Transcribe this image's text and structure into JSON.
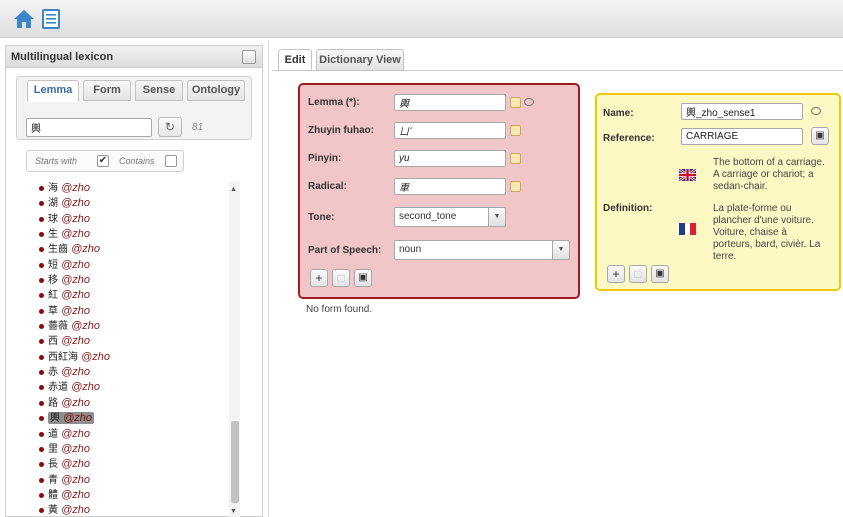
{
  "topbar": {
    "home_icon": "home-icon",
    "list_icon": "list-icon"
  },
  "left_panel": {
    "title": "Multilingual lexicon",
    "tabs": [
      "Lemma",
      "Form",
      "Sense",
      "Ontology"
    ],
    "active_tab": "Lemma",
    "search_value": "輿",
    "count": "81",
    "filter": {
      "starts_with_label": "Starts with",
      "starts_with_checked": true,
      "contains_label": "Contains",
      "contains_checked": false
    },
    "lemmas": [
      {
        "w": "海",
        "lang": "@zho"
      },
      {
        "w": "湖",
        "lang": "@zho"
      },
      {
        "w": "球",
        "lang": "@zho"
      },
      {
        "w": "生",
        "lang": "@zho"
      },
      {
        "w": "生齒",
        "lang": "@zho"
      },
      {
        "w": "短",
        "lang": "@zho"
      },
      {
        "w": "移",
        "lang": "@zho"
      },
      {
        "w": "紅",
        "lang": "@zho"
      },
      {
        "w": "草",
        "lang": "@zho"
      },
      {
        "w": "薔薇",
        "lang": "@zho"
      },
      {
        "w": "西",
        "lang": "@zho"
      },
      {
        "w": "西紅海",
        "lang": "@zho"
      },
      {
        "w": "赤",
        "lang": "@zho"
      },
      {
        "w": "赤道",
        "lang": "@zho"
      },
      {
        "w": "路",
        "lang": "@zho"
      },
      {
        "w": "輿",
        "lang": "@zho",
        "selected": true
      },
      {
        "w": "道",
        "lang": "@zho"
      },
      {
        "w": "里",
        "lang": "@zho"
      },
      {
        "w": "長",
        "lang": "@zho"
      },
      {
        "w": "青",
        "lang": "@zho"
      },
      {
        "w": "體",
        "lang": "@zho"
      },
      {
        "w": "黃",
        "lang": "@zho"
      }
    ]
  },
  "right_tabs": [
    "Edit",
    "Dictionary View"
  ],
  "lemma_form": {
    "lemma_label": "Lemma (*):",
    "lemma_value": "輿",
    "zhuyin_label": "Zhuyin fuhao:",
    "zhuyin_value": "ㄩˊ",
    "pinyin_label": "Pinyin:",
    "pinyin_value": "yu",
    "radical_label": "Radical:",
    "radical_value": "車",
    "tone_label": "Tone:",
    "tone_value": "second_tone",
    "pos_label": "Part of Speech:",
    "pos_value": "noun",
    "no_form": "No form found."
  },
  "sense": {
    "name_label": "Name:",
    "name_value": "輿_zho_sense1",
    "reference_label": "Reference:",
    "reference_value": "CARRIAGE",
    "definition_label": "Definition:",
    "definition_en": "The bottom of a carriage. A carriage or chariot; a sedan-chair.",
    "definition_fr": "La plate-forme ou plancher d'une voiture. Voiture, chaise à porteurs, bard, civièr. La terre."
  },
  "colors": {
    "red_border": "#9e1c22",
    "red_bg": "#f1c6c8",
    "yellow_border": "#f0c800",
    "yellow_bg": "#fdf9c4",
    "lang": "#8b1a1a"
  }
}
